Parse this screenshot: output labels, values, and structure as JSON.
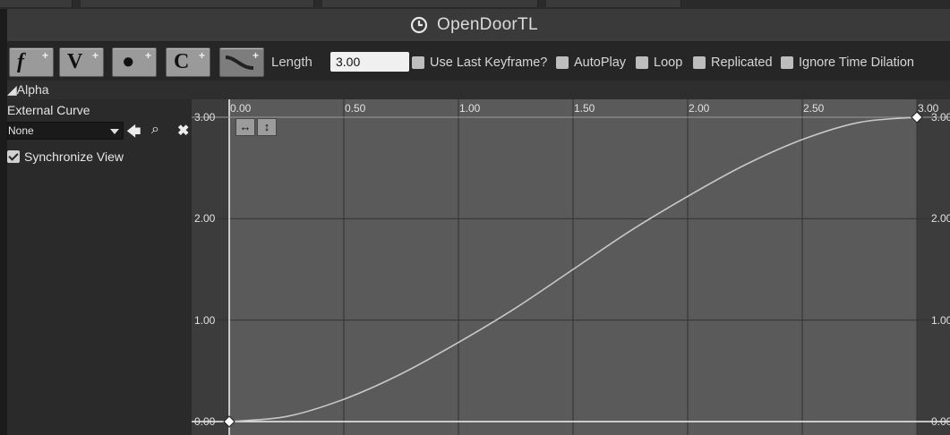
{
  "title_bar": {
    "title": "OpenDoorTL",
    "icon": "clock-icon"
  },
  "toolbar": {
    "buttons": [
      {
        "glyph": "f",
        "name": "add-float-track"
      },
      {
        "glyph": "V",
        "name": "add-vector-track"
      },
      {
        "glyph": "!",
        "name": "add-event-track"
      },
      {
        "glyph": "C",
        "name": "add-color-track"
      },
      {
        "glyph": "~",
        "name": "add-external-curve"
      }
    ],
    "length_label": "Length",
    "length_value": "3.00",
    "checkboxes": [
      {
        "label": "Use Last Keyframe?",
        "checked": false
      },
      {
        "label": "AutoPlay",
        "checked": false
      },
      {
        "label": "Loop",
        "checked": false
      },
      {
        "label": "Replicated",
        "checked": false
      },
      {
        "label": "Ignore Time Dilation",
        "checked": false
      }
    ]
  },
  "track": {
    "name": "Alpha",
    "external_curve_label": "External Curve",
    "external_curve_value": "None",
    "synchronize_view_label": "Synchronize View",
    "synchronize_view_checked": true
  },
  "curve_editor": {
    "x_ticks": [
      "0.00",
      "0.50",
      "1.00",
      "1.50",
      "2.00",
      "2.50",
      "3.00"
    ],
    "y_ticks_left": [
      "3.00",
      "2.00",
      "1.00",
      "0.00"
    ],
    "y_ticks_right": [
      "3.00",
      "2.00",
      "1.00",
      "0.00"
    ],
    "zoom_to_fit_horizontal": "↔",
    "zoom_to_fit_vertical": "↕",
    "curve_color": "#c8c8c8",
    "background_active": "#5a5a5a",
    "background_outside": "#3c3c3c"
  },
  "chart_data": {
    "type": "line",
    "xlim": [
      0,
      3
    ],
    "ylim": [
      0,
      3
    ],
    "keys": [
      {
        "x": 0,
        "y": 0
      },
      {
        "x": 3,
        "y": 3
      }
    ],
    "interpolation": "cubic-auto",
    "x": [
      0,
      0.25,
      0.5,
      0.75,
      1.0,
      1.25,
      1.5,
      1.75,
      2.0,
      2.25,
      2.5,
      2.75,
      3.0
    ],
    "y": [
      0,
      0.05,
      0.22,
      0.47,
      0.78,
      1.12,
      1.5,
      1.88,
      2.22,
      2.53,
      2.78,
      2.95,
      3.0
    ]
  }
}
